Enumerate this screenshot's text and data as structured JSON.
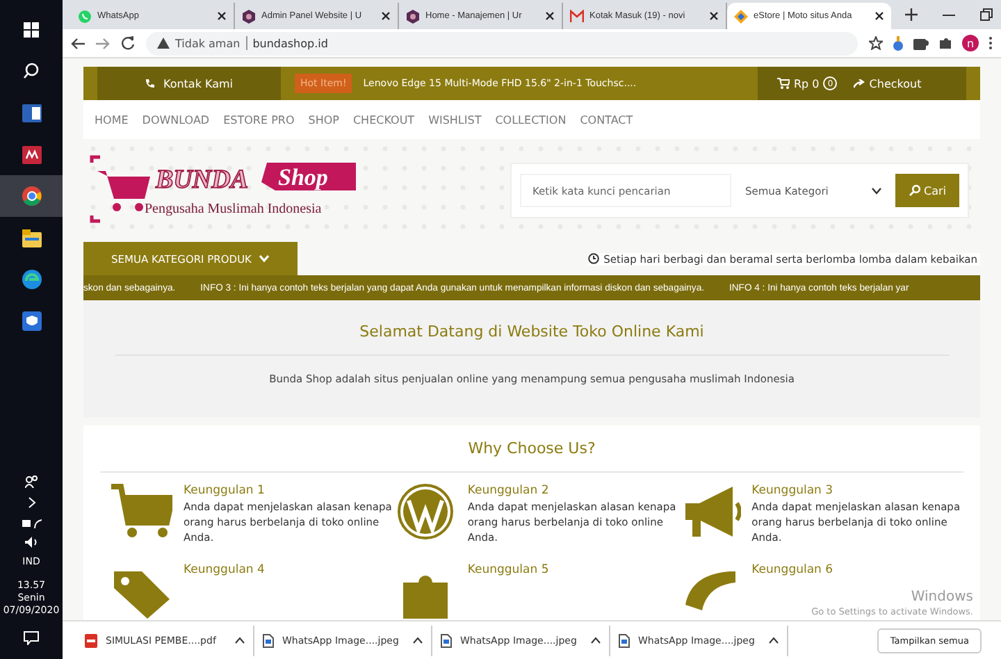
{
  "taskbar": {
    "language": "IND",
    "time": "13.57",
    "day": "Senin",
    "date": "07/09/2020"
  },
  "browser": {
    "tabs": [
      {
        "title": "WhatsApp",
        "selected": false
      },
      {
        "title": "Admin Panel Website | U",
        "selected": false
      },
      {
        "title": "Home - Manajemen | Ur",
        "selected": false
      },
      {
        "title": "Kotak Masuk (19) - novi",
        "selected": false
      },
      {
        "title": "eStore | Moto situs Anda",
        "selected": true
      }
    ],
    "address": {
      "security": "Tidak aman",
      "url": "bundashop.id"
    },
    "profile": "n"
  },
  "site": {
    "topbar": {
      "contact": "Kontak Kami",
      "hot_label": "Hot Item!",
      "hot_item": "Lenovo Edge 15 Multi-Mode FHD 15.6\" 2-in-1 Touchsc....",
      "cart_total": "Rp 0",
      "cart_count": "0",
      "checkout": "Checkout"
    },
    "nav": [
      "HOME",
      "DOWNLOAD",
      "ESTORE PRO",
      "SHOP",
      "CHECKOUT",
      "WISHLIST",
      "COLLECTION",
      "CONTACT"
    ],
    "logo": {
      "word1": "BUNDA",
      "word2": "Shop",
      "tagline": "Pengusaha Muslimah Indonesia"
    },
    "search": {
      "placeholder": "Ketik kata kunci pencarian",
      "category": "Semua Kategori",
      "button": "Cari"
    },
    "category_button": "SEMUA KATEGORI PRODUK",
    "notice": "Setiap hari berbagi dan beramal serta berlomba lomba dalam kebaikan",
    "marquee": [
      "skon dan sebagainya.",
      "INFO 3 : Ini hanya contoh teks berjalan yang dapat Anda gunakan untuk menampilkan informasi diskon dan sebagainya.",
      "INFO 4 : Ini hanya contoh teks berjalan yar"
    ],
    "welcome": {
      "title": "Selamat Datang di Website Toko Online Kami",
      "text": "Bunda Shop adalah situs penjualan online yang menampung semua pengusaha muslimah Indonesia"
    },
    "why": {
      "title": "Why Choose Us?",
      "features": [
        {
          "title": "Keunggulan 1",
          "text": "Anda dapat menjelaskan alasan kenapa orang harus berbelanja di toko online Anda."
        },
        {
          "title": "Keunggulan 2",
          "text": "Anda dapat menjelaskan alasan kenapa orang harus berbelanja di toko online Anda."
        },
        {
          "title": "Keunggulan 3",
          "text": "Anda dapat menjelaskan alasan kenapa orang harus berbelanja di toko online Anda."
        },
        {
          "title": "Keunggulan 4"
        },
        {
          "title": "Keunggulan 5"
        },
        {
          "title": "Keunggulan 6"
        }
      ]
    }
  },
  "os_notice": {
    "title": "Windows",
    "text": "Go to Settings to activate Windows."
  },
  "downloads": {
    "items": [
      {
        "name": "SIMULASI PEMBE....pdf",
        "kind": "pdf"
      },
      {
        "name": "WhatsApp Image....jpeg",
        "kind": "file"
      },
      {
        "name": "WhatsApp Image....jpeg",
        "kind": "file"
      },
      {
        "name": "WhatsApp Image....jpeg",
        "kind": "file"
      }
    ],
    "show_all": "Tampilkan semua"
  }
}
